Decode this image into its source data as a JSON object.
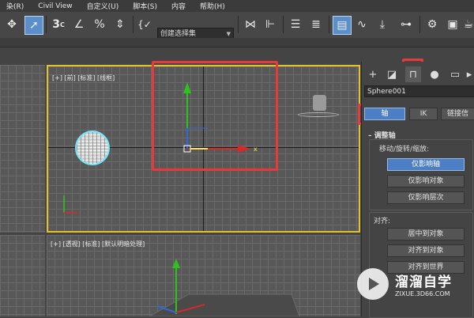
{
  "menubar": {
    "items": [
      "染(R)",
      "Civil View",
      "自定义(U)",
      "脚本(S)",
      "内容",
      "帮助(H)"
    ]
  },
  "toolbar": {
    "selection_set": "创建选择集"
  },
  "viewport_top": {
    "label": "[+] [前] [标准] [线框]"
  },
  "viewport_bottom": {
    "label": "[+] [透视] [标准] [默认明暗处理]"
  },
  "command_panel": {
    "object_name": "Sphere001",
    "tabs": {
      "pivot": "轴",
      "ik": "IK",
      "link": "链接信"
    },
    "adjust_pivot": {
      "header": "调整轴",
      "subheader": "移动/旋转/缩放:",
      "affect_pivot_only": "仅影响轴",
      "affect_object_only": "仅影响对象",
      "affect_hierarchy_only": "仅影响层次"
    },
    "alignment": {
      "label": "对齐:",
      "center_to_object": "居中到对象",
      "align_to_object": "对齐到对象",
      "align_to_world": "对齐到世界"
    }
  },
  "watermark": {
    "title": "溜溜自学",
    "url": "ZIXUE.3D66.COM"
  },
  "colors": {
    "highlight_red": "#e83a3a",
    "accent_blue": "#4d7fc4",
    "viewport_border": "#e6bf2c"
  }
}
